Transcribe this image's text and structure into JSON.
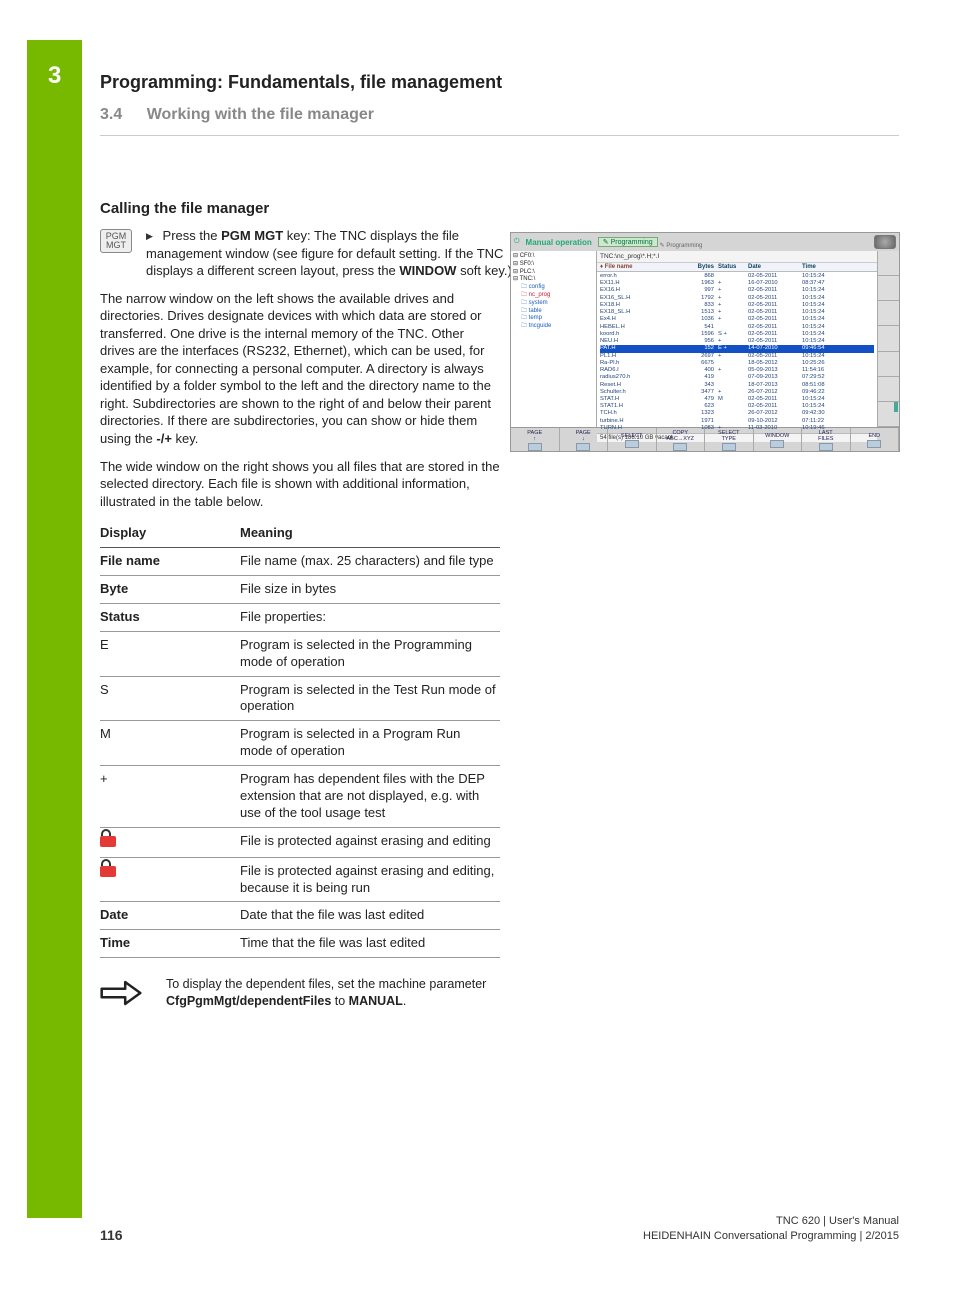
{
  "chapter": {
    "num": "3",
    "title": "Programming: Fundamentals, file management"
  },
  "section": {
    "num": "3.4",
    "title": "Working with the file manager"
  },
  "subhead": "Calling the file manager",
  "key_label": "PGM\nMGT",
  "step1_pre": "Press the ",
  "step1_bold1": "PGM MGT",
  "step1_mid": " key: The TNC displays the file management window (see figure for default setting. If the TNC displays a different screen layout, press the ",
  "step1_bold2": "WINDOW",
  "step1_post": " soft key.)",
  "para1_a": "The narrow window on the left shows the available drives and directories. Drives designate devices with which data are stored or transferred. One drive is the internal memory of the TNC. Other drives are the interfaces (RS232, Ethernet), which can be used, for example, for connecting a personal computer. A directory is always identified by a folder symbol to the left and the directory name to the right. Subdirectories are shown to the right of and below their parent directories. If there are subdirectories, you can show or hide them using the ",
  "para1_bold": "-/+",
  "para1_b": " key.",
  "para2": "The wide window on the right shows you all files that are stored in the selected directory. Each file is shown with additional information, illustrated in the table below.",
  "table": {
    "head": {
      "c1": "Display",
      "c2": "Meaning"
    },
    "rows": [
      {
        "c1": "File name",
        "c1bold": true,
        "c2": "File name (max. 25 characters) and file type"
      },
      {
        "c1": "Byte",
        "c1bold": true,
        "c2": "File size in bytes"
      },
      {
        "c1": "Status",
        "c1bold": true,
        "c2": "File properties:"
      },
      {
        "c1": "E",
        "c2": "Program is selected in the Programming mode of operation"
      },
      {
        "c1": "S",
        "c2": "Program is selected in the Test Run mode of operation"
      },
      {
        "c1": "M",
        "c2": "Program is selected in a Program Run mode of operation"
      },
      {
        "c1": "+",
        "c2": "Program has dependent files with the DEP extension that are not displayed, e.g. with use of the tool usage test"
      },
      {
        "c1": "__lock__",
        "c2": "File is protected against erasing and editing"
      },
      {
        "c1": "__lock__",
        "c2": "File is protected against erasing and editing, because it is being run"
      },
      {
        "c1": "Date",
        "c1bold": true,
        "c2": "Date that the file was last edited"
      },
      {
        "c1": "Time",
        "c1bold": true,
        "c2": "Time that the file was last edited"
      }
    ]
  },
  "note_a": "To display the dependent files, set the machine parameter ",
  "note_bold1": "CfgPgmMgt/dependentFiles",
  "note_b": " to ",
  "note_bold2": "MANUAL",
  "note_c": ".",
  "shot": {
    "mode_left": "Manual operation",
    "mode_mid": "Programming",
    "mode_sub": "Programming",
    "path": "TNC:\\nc_prog\\*.H;*.I",
    "cols": [
      "File name",
      "Bytes",
      "Status",
      "Date",
      "Time"
    ],
    "tree": {
      "drives": [
        "⊟ CF0:\\",
        "⊟ SF0:\\",
        "⊟ PLC:\\",
        "⊟ TNC:\\"
      ],
      "folders": [
        {
          "t": "config",
          "cls": "folder"
        },
        {
          "t": "nc_prog",
          "cls": "folder-alt"
        },
        {
          "t": "system",
          "cls": "folder"
        },
        {
          "t": "table",
          "cls": "folder"
        },
        {
          "t": "temp",
          "cls": "folder"
        },
        {
          "t": "tncguide",
          "cls": "folder"
        }
      ]
    },
    "files": [
      {
        "n": "error.h",
        "b": "868",
        "s": "",
        "d": "02-05-2011",
        "t": "10:15:24"
      },
      {
        "n": "EX11.H",
        "b": "1963",
        "s": "+",
        "d": "16-07-2010",
        "t": "08:37:47"
      },
      {
        "n": "EX16.H",
        "b": "997",
        "s": "+",
        "d": "02-05-2011",
        "t": "10:15:24"
      },
      {
        "n": "EX16_SL.H",
        "b": "1792",
        "s": "+",
        "d": "02-05-2011",
        "t": "10:15:24"
      },
      {
        "n": "EX18.H",
        "b": "833",
        "s": "+",
        "d": "02-05-2011",
        "t": "10:15:24"
      },
      {
        "n": "EX18_SL.H",
        "b": "1513",
        "s": "+",
        "d": "02-05-2011",
        "t": "10:15:24"
      },
      {
        "n": "Ex4.H",
        "b": "1036",
        "s": "+",
        "d": "02-05-2011",
        "t": "10:15:24"
      },
      {
        "n": "HEBEL.H",
        "b": "541",
        "s": "",
        "d": "02-05-2011",
        "t": "10:15:24"
      },
      {
        "n": "koord.h",
        "b": "1596",
        "s": "S +",
        "d": "02-05-2011",
        "t": "10:15:24"
      },
      {
        "n": "NEU.H",
        "b": "956",
        "s": "+",
        "d": "02-05-2011",
        "t": "10:15:24"
      },
      {
        "n": "PAT.H",
        "b": "152",
        "s": "E +",
        "d": "14-07-2010",
        "t": "09:46:54",
        "hl": true
      },
      {
        "n": "PL1.H",
        "b": "2697",
        "s": "+",
        "d": "02-05-2011",
        "t": "10:15:24"
      },
      {
        "n": "Ra-Pl.h",
        "b": "6675",
        "s": "",
        "d": "18-05-2012",
        "t": "10:25:26"
      },
      {
        "n": "RAD6.I",
        "b": "400",
        "s": "+",
        "d": "05-09-2013",
        "t": "11:54:16"
      },
      {
        "n": "radius270.h",
        "b": "419",
        "s": "",
        "d": "07-09-2013",
        "t": "07:29:52"
      },
      {
        "n": "Reset.H",
        "b": "343",
        "s": "",
        "d": "18-07-2013",
        "t": "08:51:08"
      },
      {
        "n": "Schulter.h",
        "b": "3477",
        "s": "+",
        "d": "26-07-2012",
        "t": "09:46:22"
      },
      {
        "n": "STAT.H",
        "b": "479",
        "s": "M",
        "d": "02-05-2011",
        "t": "10:15:24"
      },
      {
        "n": "STAT1.H",
        "b": "623",
        "s": "",
        "d": "02-05-2011",
        "t": "10:15:24"
      },
      {
        "n": "TCH.h",
        "b": "1323",
        "s": "",
        "d": "26-07-2012",
        "t": "09:42:30"
      },
      {
        "n": "turbine.H",
        "b": "1971",
        "s": "",
        "d": "09-10-2012",
        "t": "07:11:22"
      },
      {
        "n": "TURN.H",
        "b": "1083",
        "s": "+",
        "d": "11-03-2010",
        "t": "10:19:46"
      }
    ],
    "status": "54  file(s) 186.10 GB vacant",
    "softkeys": [
      "PAGE\n↑",
      "PAGE\n↓",
      "SELECT",
      "COPY\nABC→XYZ",
      "SELECT\nTYPE",
      "WINDOW",
      "LAST\nFILES",
      "END"
    ]
  },
  "footer": {
    "page": "116",
    "line1": "TNC 620 | User's Manual",
    "line2": "HEIDENHAIN Conversational Programming | 2/2015"
  }
}
